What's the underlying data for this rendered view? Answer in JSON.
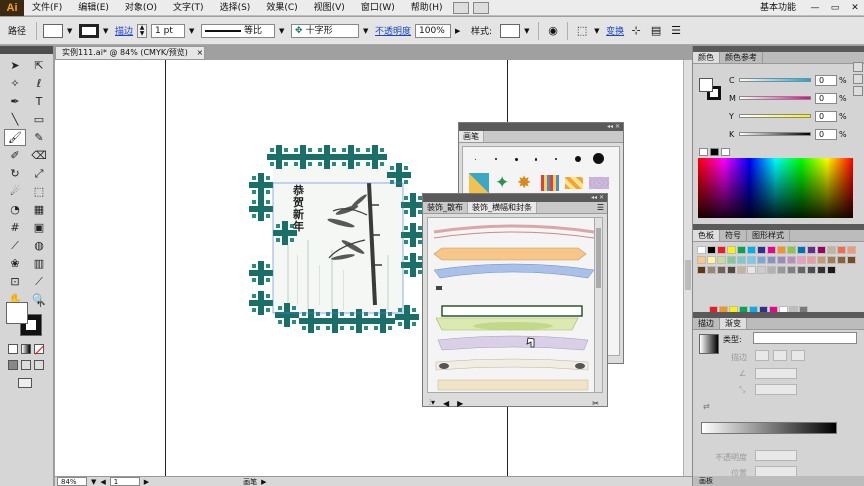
{
  "app": {
    "logo": "Ai",
    "workspace": "基本功能"
  },
  "menu": [
    "文件(F)",
    "编辑(E)",
    "对象(O)",
    "文字(T)",
    "选择(S)",
    "效果(C)",
    "视图(V)",
    "窗口(W)",
    "帮助(H)"
  ],
  "control": {
    "selection_label": "路径",
    "stroke_link": "描边",
    "stroke_weight": "1 pt",
    "profile_label": "等比",
    "brush_name": "十字形",
    "opacity_link": "不透明度",
    "opacity_value": "100%",
    "style_label": "样式:",
    "transform_link": "变换"
  },
  "document": {
    "tab_title": "实例111.ai* @ 84% (CMYK/预览)",
    "close": "×",
    "artwork_text": [
      "恭",
      "贺",
      "新",
      "年"
    ]
  },
  "status": {
    "zoom": "84%",
    "page": "1",
    "tool": "画笔"
  },
  "brush_panel": {
    "title": "画笔"
  },
  "deco_panel": {
    "tabs": [
      "装饰_散布",
      "装饰_横幅和封条"
    ],
    "footer_icons": [
      "library-icon",
      "prev-icon",
      "next-icon",
      "delete-icon"
    ]
  },
  "color_panel": {
    "tabs": [
      "颜色",
      "颜色参考"
    ],
    "channels": [
      {
        "label": "C",
        "value": "0",
        "grad": "linear-gradient(90deg,#fff,#00aeef)"
      },
      {
        "label": "M",
        "value": "0",
        "grad": "linear-gradient(90deg,#fff,#ec008c)"
      },
      {
        "label": "Y",
        "value": "0",
        "grad": "linear-gradient(90deg,#fff,#fff200)"
      },
      {
        "label": "K",
        "value": "0",
        "grad": "linear-gradient(90deg,#fff,#000)"
      }
    ],
    "pct": "%"
  },
  "swatch_panel": {
    "tabs": [
      "色板",
      "符号",
      "图形样式"
    ],
    "colors": [
      "#ffffff",
      "#000000",
      "#ed1c24",
      "#fff200",
      "#00a651",
      "#00aeef",
      "#2e3192",
      "#ec008c",
      "#f7941d",
      "#8dc63f",
      "#0072bc",
      "#662d91",
      "#9e005d",
      "#c2b59b",
      "#f26c4f",
      "#f69679",
      "#fdc689",
      "#fff799",
      "#c4df9b",
      "#82ca9c",
      "#7accc8",
      "#6dcff6",
      "#7da7d9",
      "#8493ca",
      "#a187be",
      "#bd8cbf",
      "#f49ac1",
      "#f5989d",
      "#c69c6d",
      "#a67c52",
      "#8c6239",
      "#754c24",
      "#603913",
      "#998675",
      "#736357",
      "#534741",
      "#c7b299",
      "#e6e6e6",
      "#cccccc",
      "#b3b3b3",
      "#999999",
      "#808080",
      "#666666",
      "#4d4d4d",
      "#333333",
      "#1a1a1a"
    ],
    "group_colors": [
      "#ed1c24",
      "#f7941d",
      "#fff200",
      "#00a651",
      "#00aeef",
      "#2e3192",
      "#ec008c",
      "#ffffff",
      "#bdbdbd",
      "#7a7a7a"
    ]
  },
  "stroke_panel": {
    "tabs": [
      "描边",
      "渐变"
    ],
    "type_label": "类型:",
    "stroke_label": "描边",
    "opacity_label": "不透明度",
    "position_label": "位置"
  },
  "bottom_tab": "画板"
}
